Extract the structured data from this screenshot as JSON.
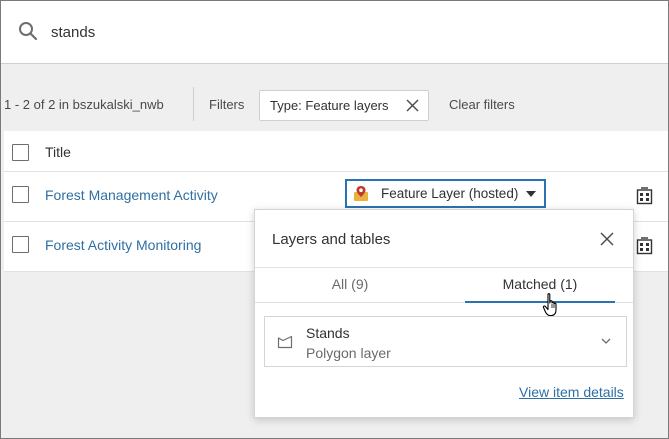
{
  "search": {
    "value": "stands"
  },
  "filters": {
    "results_count": "1 - 2 of 2 in bszukalski_nwb",
    "filters_label": "Filters",
    "chip_label": "Type: Feature layers",
    "clear_label": "Clear filters"
  },
  "table": {
    "header_title": "Title",
    "rows": [
      {
        "title": "Forest Management Activity",
        "type_label": "Feature Layer (hosted)"
      },
      {
        "title": "Forest Activity Monitoring"
      }
    ]
  },
  "popover": {
    "title": "Layers and tables",
    "tabs": [
      {
        "label": "All (9)"
      },
      {
        "label": "Matched (1)"
      }
    ],
    "selected_tab": "Matched (1)",
    "layer": {
      "name": "Stands",
      "type": "Polygon layer"
    },
    "view_details_label": "View item details"
  },
  "icons": {
    "search": "search-icon",
    "chip_close": "close-icon",
    "feature_layer": "feature-layer-icon",
    "org": "organization-icon",
    "popover_close": "close-icon",
    "polygon": "polygon-icon",
    "chevron": "chevron-down-icon",
    "cursor": "hand-pointer-icon"
  },
  "colors": {
    "accent": "#2b72b2",
    "link": "#2f6fa3",
    "background": "#efefef"
  }
}
